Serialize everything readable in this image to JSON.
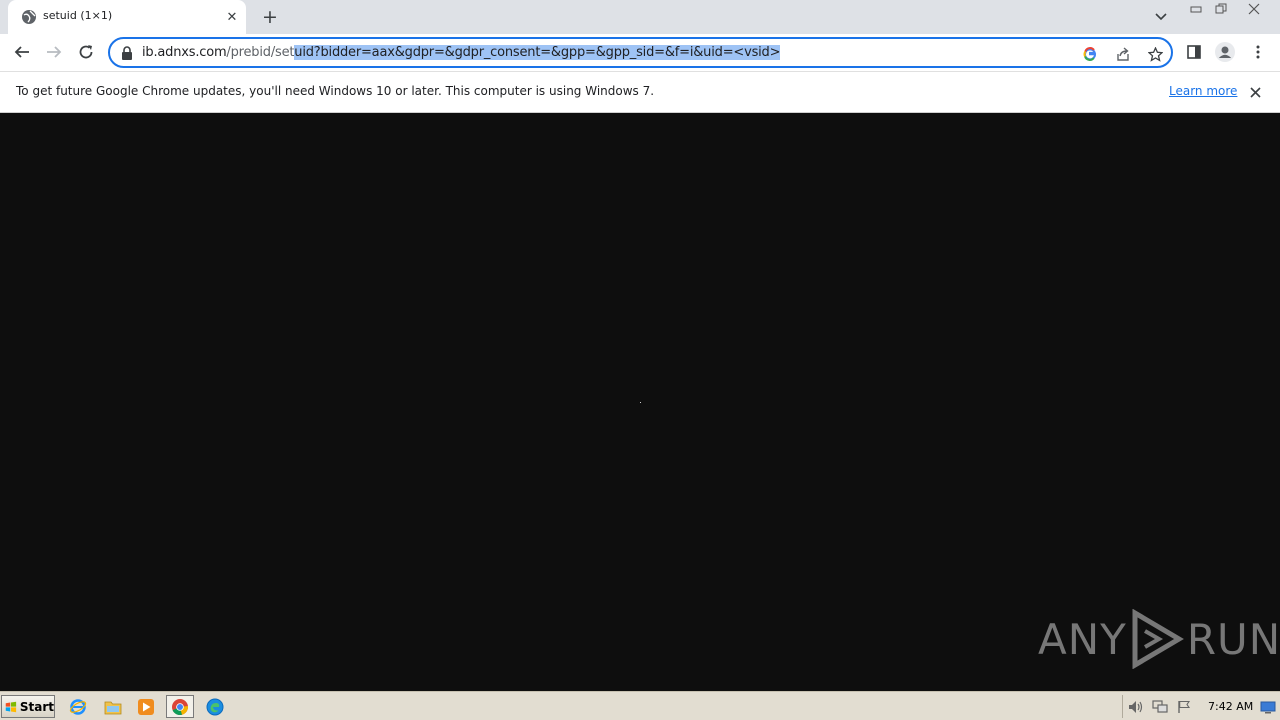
{
  "window": {
    "tab_title": "setuid (1×1)",
    "new_tab_symbol": "+"
  },
  "toolbar": {
    "url_host": "ib.adnxs.com",
    "url_path_plain": "/prebid/set",
    "url_path_selected": "uid?bidder=aax&gdpr=&gdpr_consent=&gpp=&gpp_sid=&f=i&uid=<vsid>"
  },
  "infobar": {
    "message": "To get future Google Chrome updates, you'll need Windows 10 or later. This computer is using Windows 7.",
    "link": "Learn more"
  },
  "watermark": {
    "left": "ANY",
    "right": "RUN"
  },
  "taskbar": {
    "start_label": "Start",
    "clock": "7:42 AM"
  },
  "colors": {
    "accent": "#1a73e8",
    "selection": "#9ec3f5",
    "page_background": "#0e0e0e",
    "tabstrip": "#dee1e6"
  }
}
